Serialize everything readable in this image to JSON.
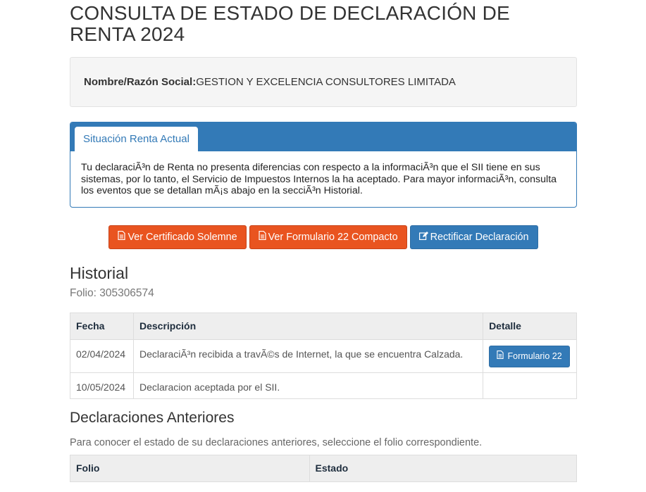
{
  "page_title": "CONSULTA DE ESTADO DE DECLARACIÓN DE RENTA 2024",
  "taxpayer": {
    "label": "Nombre/Razón Social:",
    "value": "GESTION Y EXCELENCIA CONSULTORES LIMITADA"
  },
  "situation_panel": {
    "tab_label": "Situación Renta Actual",
    "message": "Tu declaraciÃ³n de Renta no presenta diferencias con respecto a la informaciÃ³n que el SII tiene en sus sistemas, por lo tanto, el Servicio de Impuestos Internos la ha aceptado. Para mayor informaciÃ³n, consulta los eventos que se detallan mÃ¡s abajo en la secciÃ³n Historial."
  },
  "actions": {
    "certificado_label": "Ver Certificado Solemne",
    "formulario_label": "Ver Formulario 22 Compacto",
    "rectificar_label": "Rectificar Declaración",
    "colors": {
      "orange": "#e95420",
      "blue": "#337ab7"
    }
  },
  "historial": {
    "heading": "Historial",
    "folio_line": "Folio: 305306574",
    "columns": [
      "Fecha",
      "Descripción",
      "Detalle"
    ],
    "rows": [
      {
        "fecha": "02/04/2024",
        "descripcion": "DeclaraciÃ³n recibida a travÃ©s de Internet, la que se encuentra Calzada.",
        "detalle_button": "Formulario 22"
      },
      {
        "fecha": "10/05/2024",
        "descripcion": "Declaracion aceptada por el SII.",
        "detalle_button": ""
      }
    ]
  },
  "anteriores": {
    "heading": "Declaraciones Anteriores",
    "description": "Para conocer el estado de su declaraciones anteriores, seleccione el folio correspondiente.",
    "columns": [
      "Folio",
      "Estado"
    ]
  }
}
